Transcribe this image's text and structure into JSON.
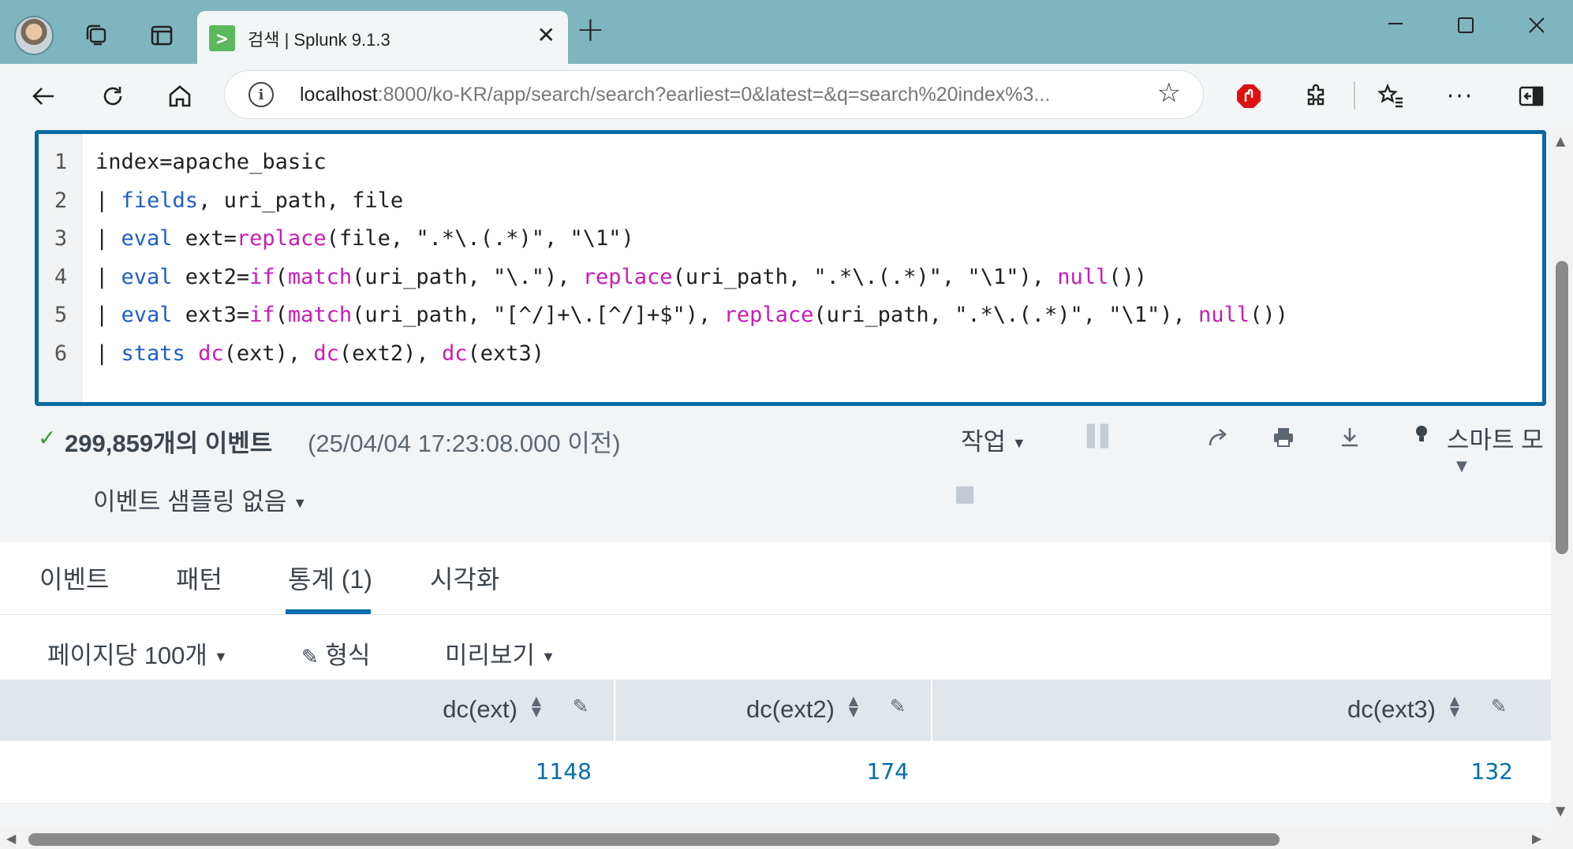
{
  "browser": {
    "tab_title": "검색 | Splunk 9.1.3",
    "favicon_glyph": ">",
    "close_glyph": "✕",
    "newtab_glyph": "+",
    "url_host": "localhost",
    "url_rest": ":8000/ko-KR/app/search/search?earliest=0&latest=&q=search%20index%3...",
    "icons": [
      "avatar",
      "workspaces-icon",
      "tab-actions-icon",
      "back-icon",
      "refresh-icon",
      "home-icon",
      "info-icon",
      "favorite-star-icon",
      "adblock-icon",
      "extensions-icon",
      "favorites-icon",
      "more-icon",
      "sidebar-icon",
      "minimize-icon",
      "maximize-icon",
      "close-window-icon"
    ]
  },
  "editor": {
    "lines": [
      {
        "num": "1",
        "parts": [
          {
            "t": "index=apache_basic",
            "c": ""
          }
        ]
      },
      {
        "num": "2",
        "parts": [
          {
            "t": "| ",
            "c": ""
          },
          {
            "t": "fields",
            "c": "kw"
          },
          {
            "t": ", uri_path, file",
            "c": ""
          }
        ]
      },
      {
        "num": "3",
        "parts": [
          {
            "t": "| ",
            "c": ""
          },
          {
            "t": "eval",
            "c": "kw"
          },
          {
            "t": " ext=",
            "c": ""
          },
          {
            "t": "replace",
            "c": "fn"
          },
          {
            "t": "(file, \".*\\.(.*)\", \"\\1\")",
            "c": ""
          }
        ]
      },
      {
        "num": "4",
        "parts": [
          {
            "t": "| ",
            "c": ""
          },
          {
            "t": "eval",
            "c": "kw"
          },
          {
            "t": " ext2=",
            "c": ""
          },
          {
            "t": "if",
            "c": "fn"
          },
          {
            "t": "(",
            "c": ""
          },
          {
            "t": "match",
            "c": "fn"
          },
          {
            "t": "(uri_path, \"\\.\"), ",
            "c": ""
          },
          {
            "t": "replace",
            "c": "fn"
          },
          {
            "t": "(uri_path, \".*\\.(.*)\", \"\\1\"), ",
            "c": ""
          },
          {
            "t": "null",
            "c": "fn"
          },
          {
            "t": "())",
            "c": ""
          }
        ]
      },
      {
        "num": "5",
        "parts": [
          {
            "t": "| ",
            "c": ""
          },
          {
            "t": "eval",
            "c": "kw"
          },
          {
            "t": " ext3=",
            "c": ""
          },
          {
            "t": "if",
            "c": "fn"
          },
          {
            "t": "(",
            "c": ""
          },
          {
            "t": "match",
            "c": "fn"
          },
          {
            "t": "(uri_path, \"[^/]+\\.[^/]+$\"), ",
            "c": ""
          },
          {
            "t": "replace",
            "c": "fn"
          },
          {
            "t": "(uri_path, \".*\\.(.*)\", \"\\1\"), ",
            "c": ""
          },
          {
            "t": "null",
            "c": "fn"
          },
          {
            "t": "())",
            "c": ""
          }
        ]
      },
      {
        "num": "6",
        "parts": [
          {
            "t": "| ",
            "c": ""
          },
          {
            "t": "stats",
            "c": "kw"
          },
          {
            "t": " ",
            "c": ""
          },
          {
            "t": "dc",
            "c": "fn"
          },
          {
            "t": "(ext), ",
            "c": ""
          },
          {
            "t": "dc",
            "c": "fn"
          },
          {
            "t": "(ext2), ",
            "c": ""
          },
          {
            "t": "dc",
            "c": "fn"
          },
          {
            "t": "(ext3)",
            "c": ""
          }
        ]
      }
    ]
  },
  "status": {
    "check": "✓",
    "event_count": "299,859개의 이벤트",
    "event_time": "(25/04/04 17:23:08.000 이전)",
    "job_label": "작업",
    "smart_mode": "스마트 모",
    "sampling": "이벤트 샘플링 없음"
  },
  "result_tabs": [
    {
      "label": "이벤트"
    },
    {
      "label": "패턴"
    },
    {
      "label": "통계 (1)",
      "active": true
    },
    {
      "label": "시각화"
    }
  ],
  "table_toolbar": {
    "per_page": "페이지당 100개",
    "format": "형식",
    "preview": "미리보기"
  },
  "table": {
    "columns": [
      "dc(ext)",
      "dc(ext2)",
      "dc(ext3)"
    ],
    "rows": [
      [
        "1148",
        "174",
        "132"
      ]
    ]
  },
  "colors": {
    "accent": "#006eaa",
    "keyword": "#1d5fc7",
    "function": "#c81cb8",
    "editor_border": "#0b6aa2",
    "success": "#3c9a3c"
  }
}
